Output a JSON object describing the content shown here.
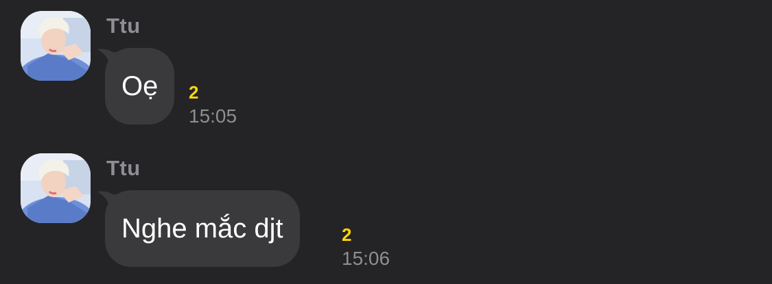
{
  "colors": {
    "background": "#242426",
    "bubble": "#3a3a3c",
    "message_text": "#ffffff",
    "meta_text": "#8e8e93",
    "unread_count": "#ffd60a"
  },
  "messages": [
    {
      "sender": "Ttu",
      "avatar_icon": "profile-photo-avatar",
      "text": "Oẹ",
      "unread_count": "2",
      "time": "15:05"
    },
    {
      "sender": "Ttu",
      "avatar_icon": "profile-photo-avatar",
      "text": "Nghe mắc djt",
      "unread_count": "2",
      "time": "15:06"
    }
  ]
}
